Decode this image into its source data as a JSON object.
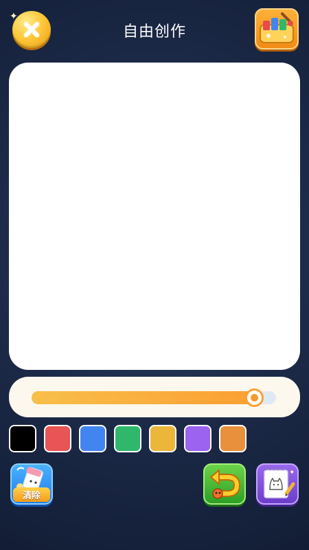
{
  "header": {
    "title": "自由创作",
    "close_icon": "close-x-icon",
    "gallery_icon": "paint-box-icon"
  },
  "canvas": {
    "background": "#ffffff"
  },
  "brush_size": {
    "value_fraction": 0.91,
    "fill_color": "#fba033",
    "track_color": "#dfe9f5"
  },
  "palette": {
    "colors": [
      "#000000",
      "#e85555",
      "#4285f0",
      "#2fb86c",
      "#ecb63a",
      "#9b63f0",
      "#e8903c"
    ],
    "selected_index": 0
  },
  "toolbar": {
    "clear_label": "清除",
    "clear_icon": "eraser-icon",
    "undo_icon": "undo-arrow-icon",
    "sketch_icon": "cat-sketchbook-icon"
  }
}
